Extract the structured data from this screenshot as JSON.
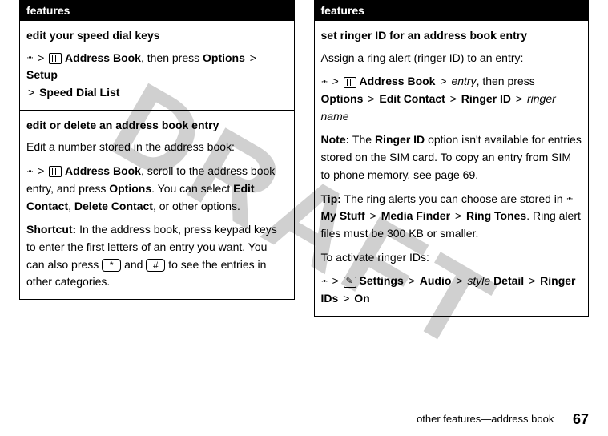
{
  "watermark": "DRAFT",
  "left": {
    "header": "features",
    "cells": [
      {
        "title": "edit your speed dial keys",
        "p1_key": "·•·",
        "p1_gt1": ">",
        "p1_ab": "Address Book",
        "p1_then": ", then press",
        "p1_opt": "Options",
        "p1_gt2": ">",
        "p1_setup": "Setup",
        "p2_gt": ">",
        "p2_sdl": "Speed Dial List"
      },
      {
        "title": "edit or delete an address book entry",
        "intro": "Edit a number stored in the address book:",
        "p1_key": "·•·",
        "p1_gt1": ">",
        "p1_ab": "Address Book",
        "p1_rest": ", scroll to the address book entry, and press",
        "p1_opt": "Options",
        "p1_sel": ". You can select",
        "p1_ec": "Edit Contact",
        "p1_comma": ",",
        "p1_dc": "Delete Contact",
        "p1_end": ", or other options.",
        "sc_label": "Shortcut:",
        "sc_a": "In the address book, press keypad keys to enter the first letters of an entry you want. You can also press",
        "sc_star": "*",
        "sc_and": "and",
        "sc_hash": "#",
        "sc_b": "to see the entries in other categories."
      }
    ]
  },
  "right": {
    "header": "features",
    "cell": {
      "title": "set ringer ID for an address book entry",
      "assign": "Assign a ring alert (ringer ID) to an entry:",
      "p1_key": "·•·",
      "p1_gt1": ">",
      "p1_ab": "Address Book",
      "p1_gt2": ">",
      "p1_entry": "entry",
      "p1_then": ", then press",
      "p2_opt": "Options",
      "p2_gt1": ">",
      "p2_ec": "Edit Contact",
      "p2_gt2": ">",
      "p2_rid": "Ringer ID",
      "p2_gt3": ">",
      "p2_rn": "ringer name",
      "note_label": "Note:",
      "note_a": "The",
      "note_rid": "Ringer ID",
      "note_b": "option isn't available for entries stored on the SIM card. To copy an entry from SIM to phone memory, see page 69.",
      "tip_label": "Tip:",
      "tip_a": "The ring alerts you can choose are stored in",
      "tip_key": "·•·",
      "tip_ms": "My Stuff",
      "tip_gt1": ">",
      "tip_mf": "Media Finder",
      "tip_gt2": ">",
      "tip_rt": "Ring Tones",
      "tip_b": ". Ring alert files must be 300 KB or smaller.",
      "act": "To activate ringer IDs:",
      "a_key": "·•·",
      "a_gt1": ">",
      "a_set": "Settings",
      "a_gt2": ">",
      "a_audio": "Audio",
      "a_gt3": ">",
      "a_style": "style",
      "a_detail": "Detail",
      "a_gt4": ">",
      "a_rids": "Ringer IDs",
      "a_gt5": ">",
      "a_on": "On"
    }
  },
  "footer": {
    "text": "other features—address book",
    "page": "67"
  }
}
